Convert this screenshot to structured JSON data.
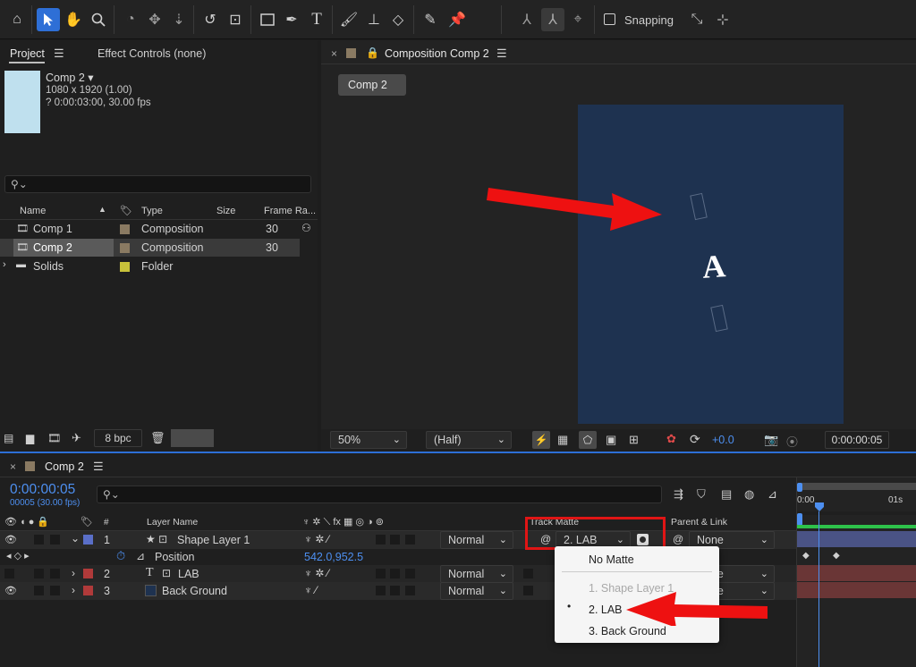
{
  "toolbar": {
    "snapping_label": "Snapping"
  },
  "project_panel": {
    "tab_project": "Project",
    "tab_effect_controls": "Effect Controls (none)",
    "comp_name": "Comp 2",
    "comp_dims": "1080 x 1920 (1.00)",
    "comp_duration": "? 0:00:03:00, 30.00 fps",
    "columns": {
      "name": "Name",
      "type": "Type",
      "size": "Size",
      "frame_rate": "Frame Ra..."
    },
    "items": [
      {
        "name": "Comp 1",
        "type": "Composition",
        "frame_rate": "30",
        "color": "#8a7a62"
      },
      {
        "name": "Comp 2",
        "type": "Composition",
        "frame_rate": "30",
        "color": "#8a7a62"
      },
      {
        "name": "Solids",
        "type": "Folder",
        "frame_rate": "",
        "color": "#c8c23a"
      }
    ],
    "bpc": "8 bpc"
  },
  "composition_panel": {
    "tab_title": "Composition Comp 2",
    "comp_button": "Comp 2",
    "canvas_letter": "A",
    "zoom": "50%",
    "resolution": "(Half)",
    "exposure": "+0.0",
    "timecode": "0:00:00:05",
    "canvas_color": "#1e3250"
  },
  "timeline": {
    "tab_title": "Comp 2",
    "current_time": "0:00:00:05",
    "current_frame": "00005 (30.00 fps)",
    "headers": {
      "number": "#",
      "layer_name": "Layer Name",
      "track_matte": "Track Matte",
      "parent_link": "Parent & Link"
    },
    "ruler": {
      "start": "0:00",
      "tick_1s": "01s"
    },
    "layers": [
      {
        "num": "1",
        "name": "Shape Layer 1",
        "mode": "Normal",
        "matte": "2. LAB",
        "parent": "None",
        "color": "#5a6fc8"
      },
      {
        "num": "2",
        "name": "LAB",
        "mode": "Normal",
        "parent": "None",
        "color": "#b03a3a"
      },
      {
        "num": "3",
        "name": "Back Ground",
        "mode": "Normal",
        "parent": "None",
        "color": "#b03a3a"
      }
    ],
    "position_prop": {
      "label": "Position",
      "value": "542.0,952.5"
    },
    "matte_menu": {
      "items": [
        "No Matte",
        "1. Shape Layer 1",
        "2. LAB",
        "3. Back Ground"
      ],
      "selected": "2. LAB"
    }
  }
}
